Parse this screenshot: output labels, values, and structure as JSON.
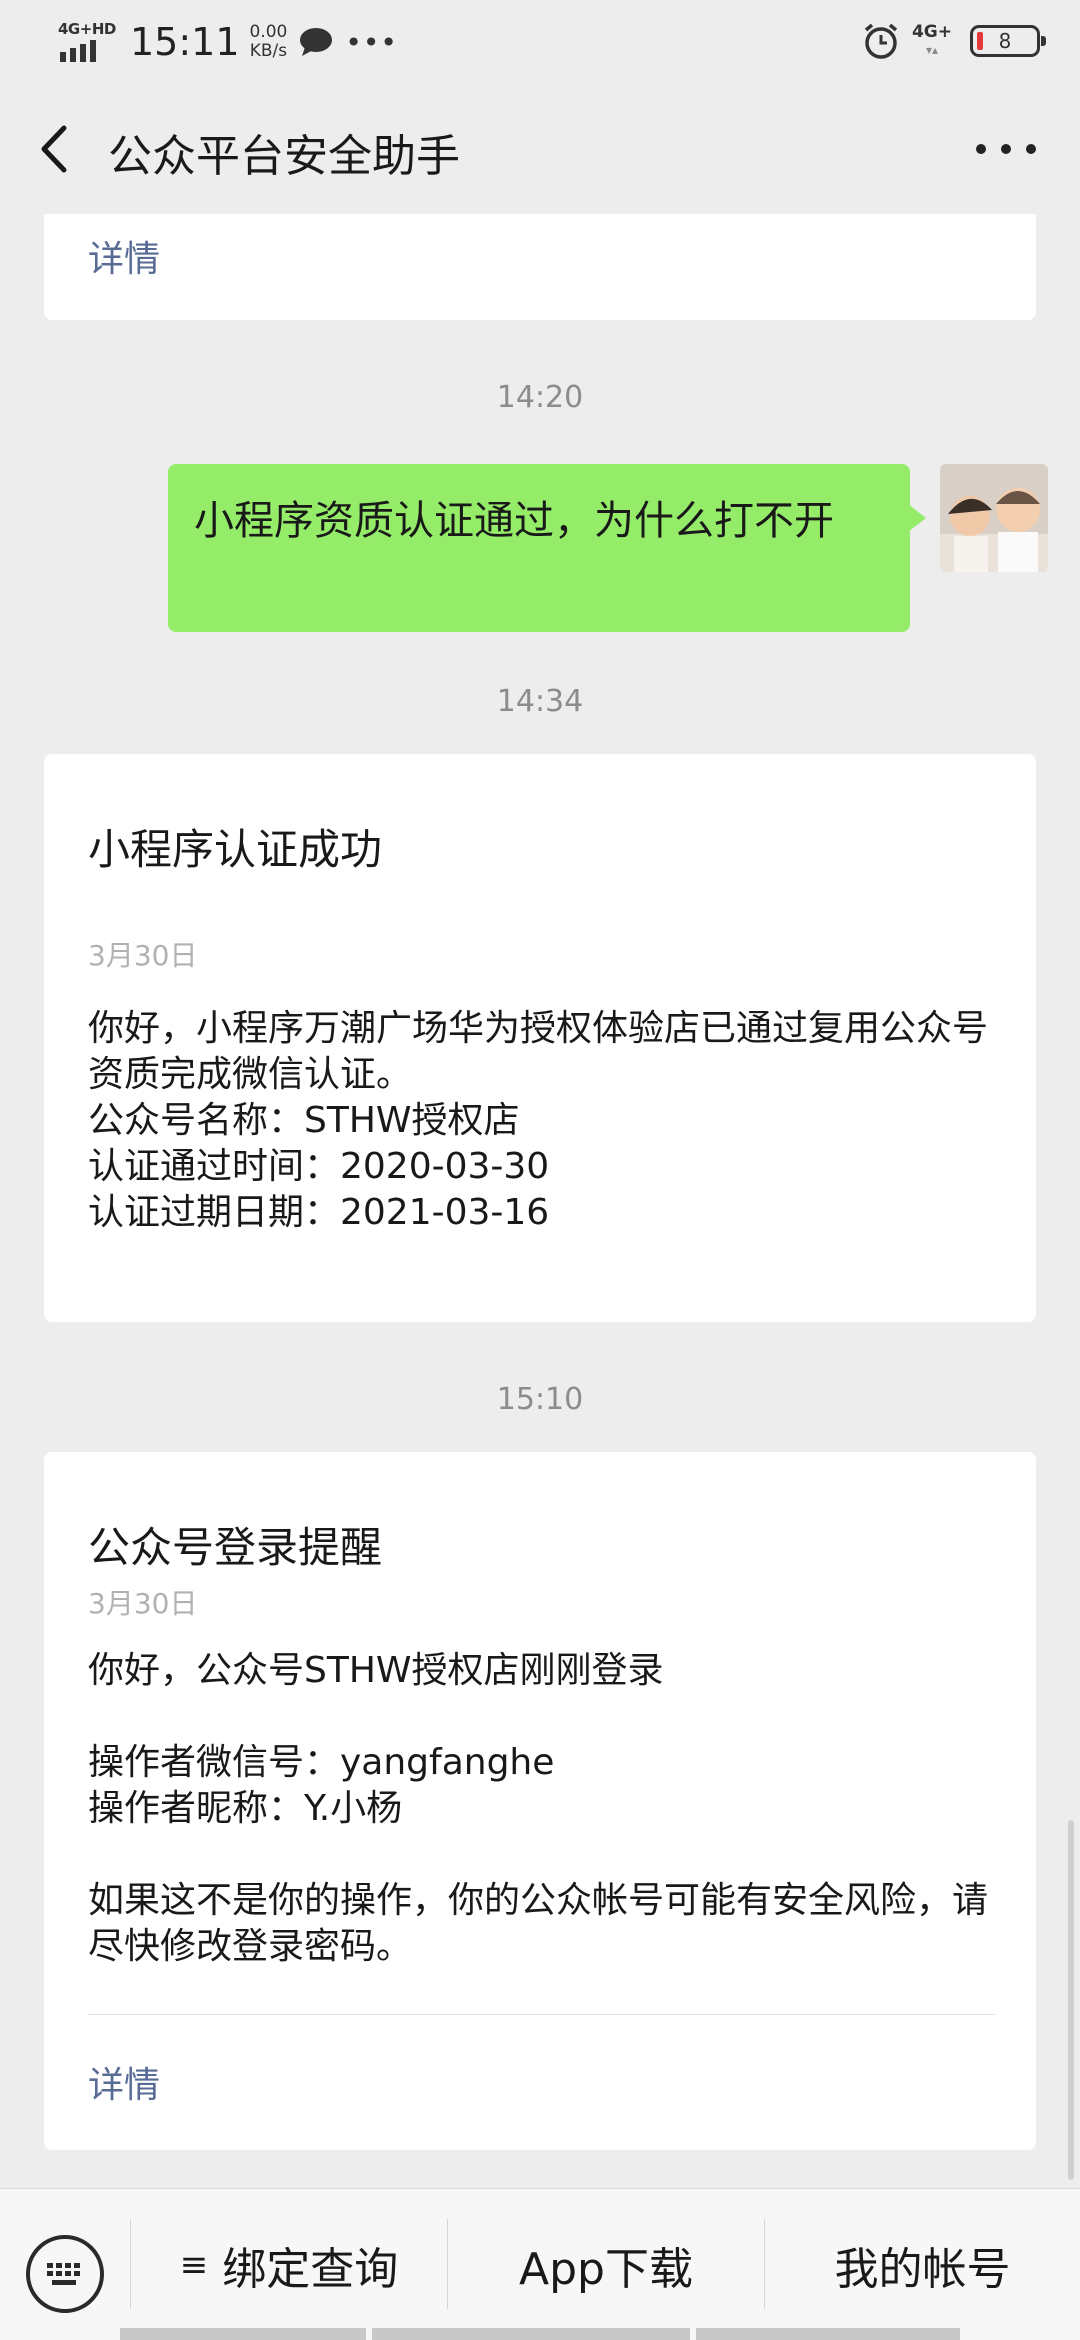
{
  "status_bar": {
    "network": "4G+HD",
    "time": "15:11",
    "speed_value": "0.00",
    "speed_unit": "KB/s",
    "network_right": "4G+",
    "battery": "8",
    "icons": [
      "signal-icon",
      "chat-bubble-icon",
      "more-dots-icon",
      "alarm-icon",
      "battery-icon"
    ]
  },
  "header": {
    "title": "公众平台安全助手",
    "back_icon": "chevron-left-icon",
    "more_icon": "more-horizontal-icon"
  },
  "messages": {
    "top_card_link": "详情",
    "time_1": "14:20",
    "user_message": "小程序资质认证通过，为什么打不开",
    "time_2": "14:34",
    "card_1": {
      "title": "小程序认证成功",
      "date": "3月30日",
      "body_1": "你好，小程序万潮广场华为授权体验店已通过复用公众号资质完成微信认证。",
      "body_2": "公众号名称：STHW授权店",
      "body_3": "认证通过时间：2020-03-30",
      "body_4": "认证过期日期：2021-03-16"
    },
    "time_3": "15:10",
    "card_2": {
      "title": "公众号登录提醒",
      "date": "3月30日",
      "body_1": "你好，公众号STHW授权店刚刚登录",
      "body_2": "操作者微信号：yangfanghe",
      "body_3": "操作者昵称：Y.小杨",
      "body_4": "如果这不是你的操作，你的公众帐号可能有安全风险，请尽快修改登录密码。",
      "link": "详情"
    }
  },
  "bottom_bar": {
    "keyboard_icon": "keyboard-icon",
    "menu_1": "绑定查询",
    "menu_1_icon": "≡",
    "menu_2": "App下载",
    "menu_3": "我的帐号"
  },
  "colors": {
    "background": "#ededed",
    "bubble": "#95ec69",
    "link": "#576b95",
    "timestamp": "#8c8c8c"
  }
}
